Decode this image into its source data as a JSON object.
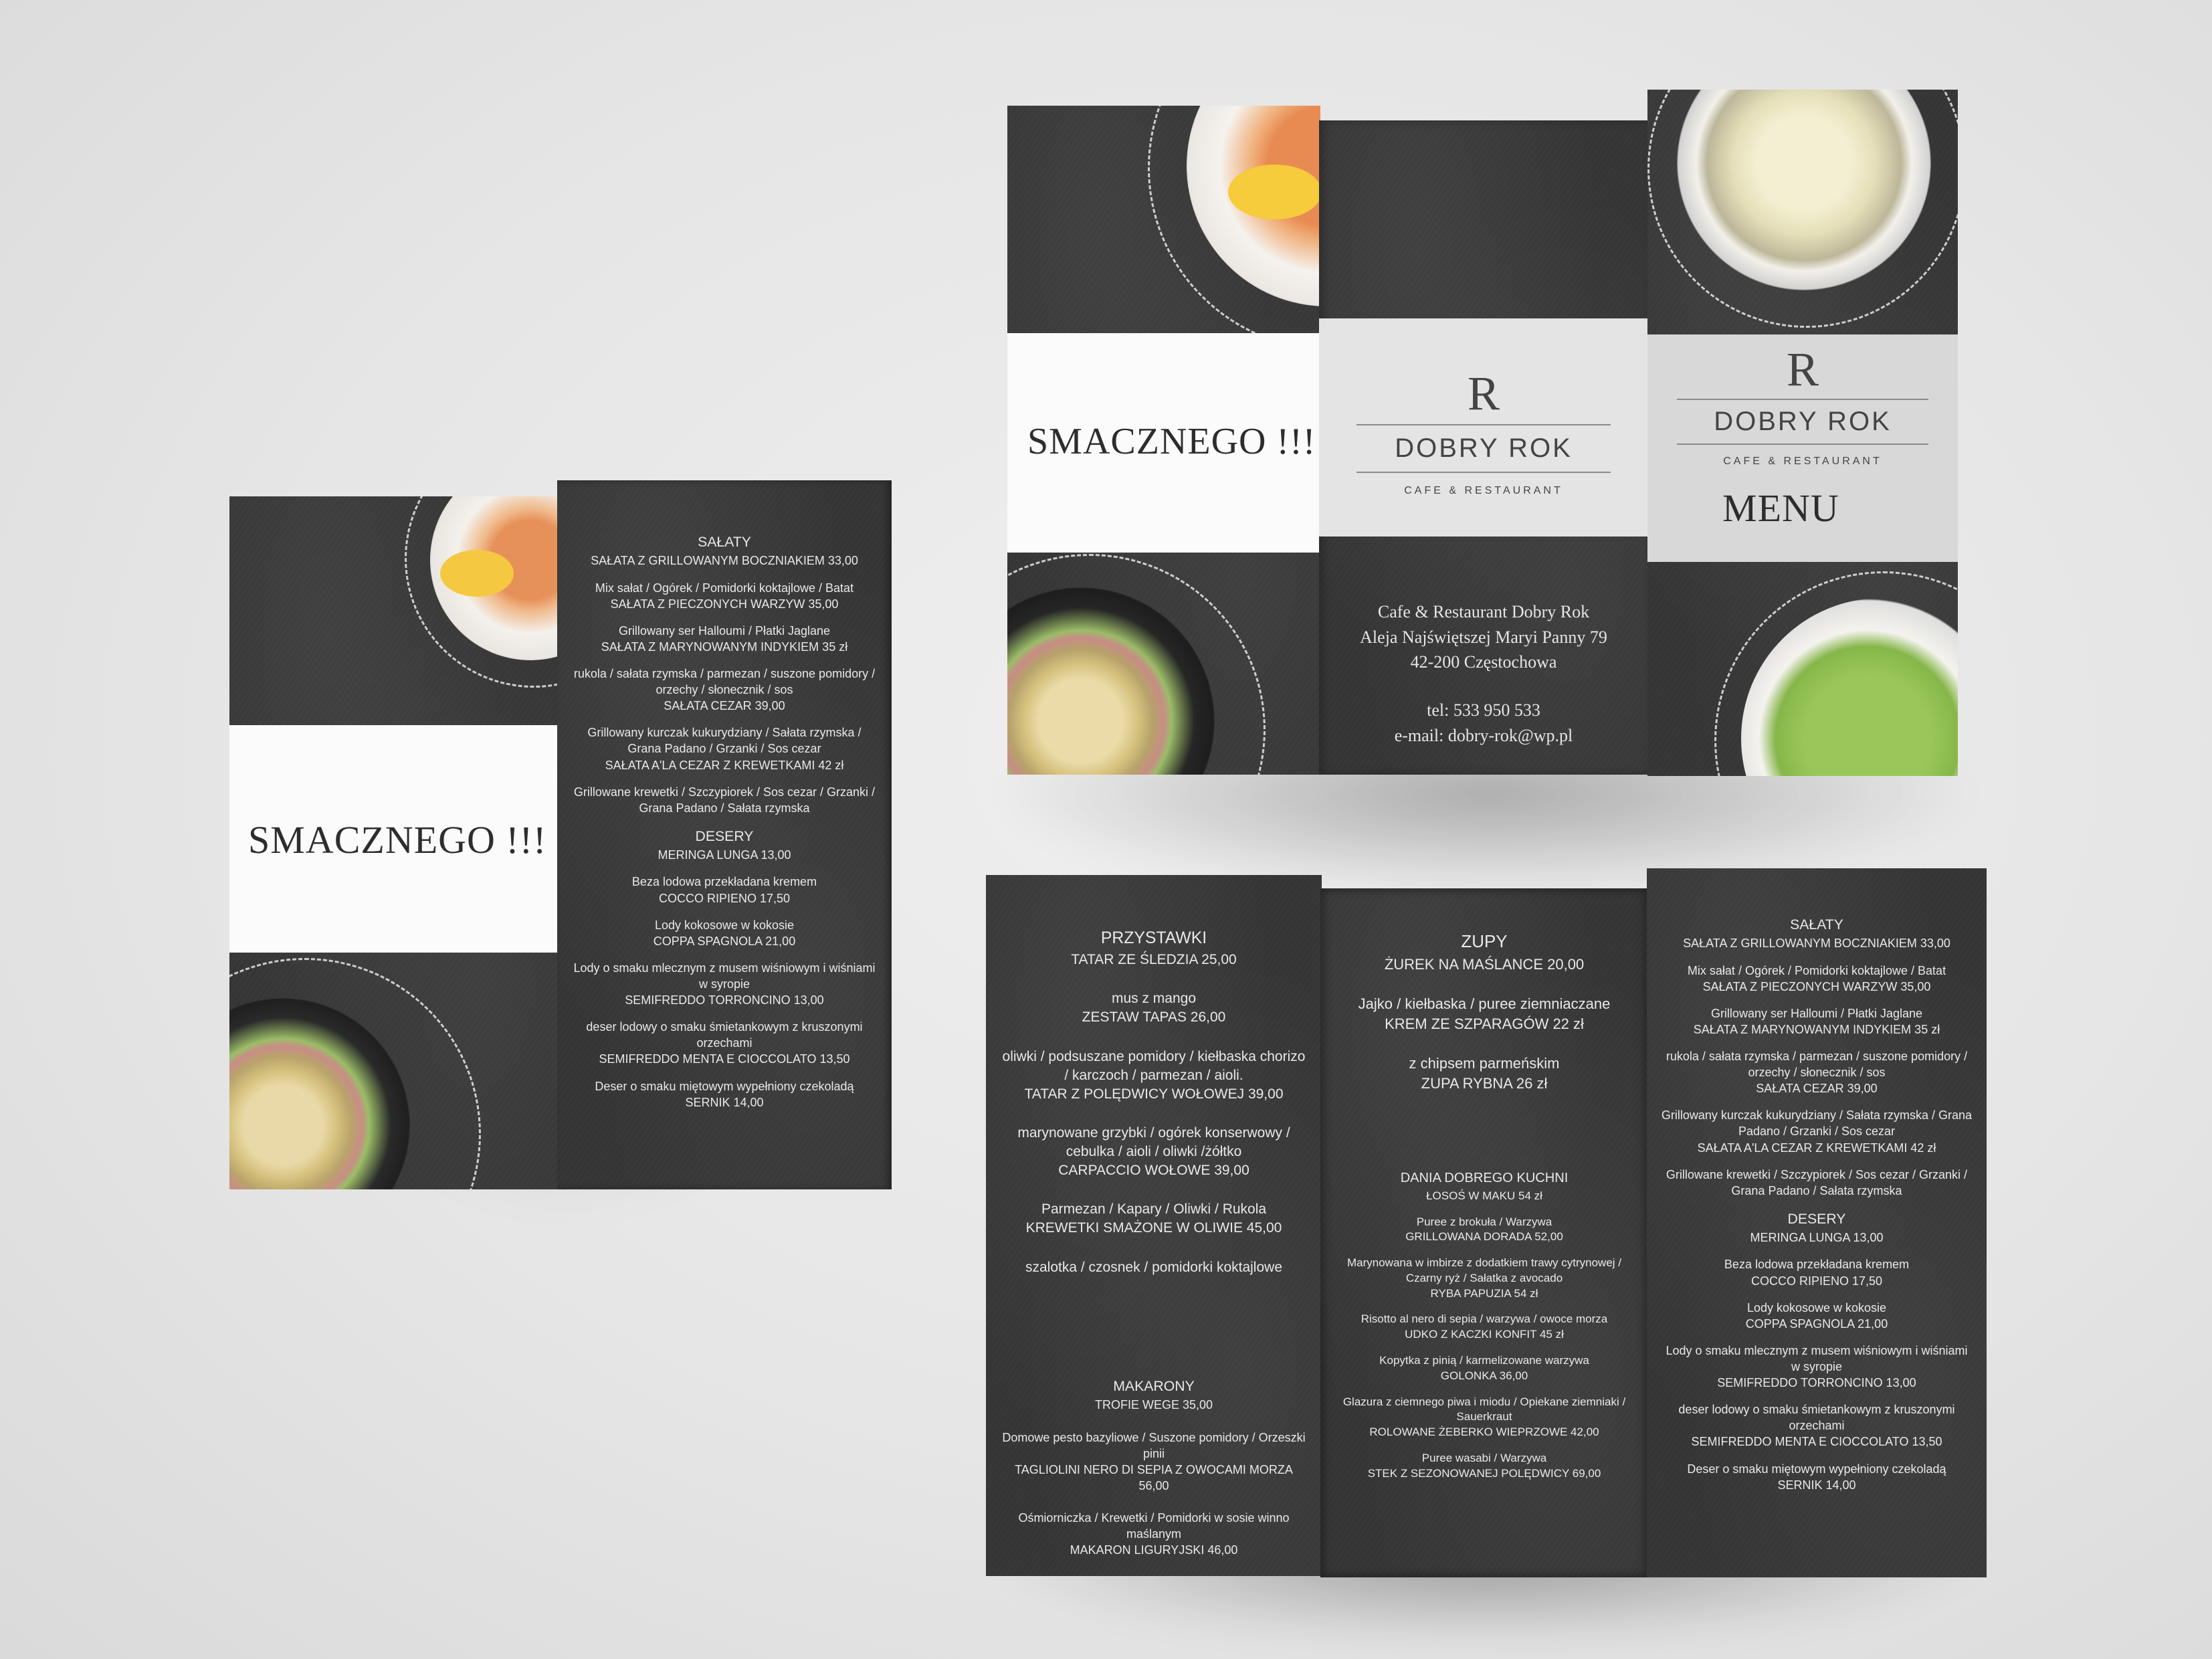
{
  "left_menu": {
    "cover_text": "SMACZNEGO !!!",
    "items": [
      {
        "head": "SAŁATY",
        "name": "SAŁATA Z GRILLOWANYM BOCZNIAKIEM 33,00"
      },
      {
        "desc": "Mix sałat / Ogórek / Pomidorki koktajlowe / Batat",
        "name": "SAŁATA Z PIECZONYCH WARZYW 35,00"
      },
      {
        "desc": "Grillowany ser Halloumi / Płatki Jaglane",
        "name": "SAŁATA Z MARYNOWANYM INDYKIEM 35 zł"
      },
      {
        "desc": "rukola / sałata rzymska / parmezan / suszone pomidory / orzechy / słonecznik / sos",
        "name": "SAŁATA CEZAR 39,00"
      },
      {
        "desc": "Grillowany kurczak kukurydziany / Sałata rzymska / Grana Padano / Grzanki / Sos cezar",
        "name": "SAŁATA A'LA CEZAR Z KREWETKAMI 42 zł"
      },
      {
        "desc": "Grillowane krewetki / Szczypiorek / Sos cezar / Grzanki / Grana Padano / Sałata rzymska",
        "name": ""
      },
      {
        "head": "DESERY",
        "name": "MERINGA LUNGA 13,00"
      },
      {
        "desc": "Beza lodowa przekładana kremem",
        "name": "COCCO RIPIENO 17,50"
      },
      {
        "desc": "Lody kokosowe w kokosie",
        "name": "COPPA SPAGNOLA 21,00"
      },
      {
        "desc": "Lody o smaku mlecznym z musem wiśniowym i wiśniami w syropie",
        "name": "SEMIFREDDO TORRONCINO 13,00"
      },
      {
        "desc": "deser lodowy o smaku śmietankowym z kruszonymi orzechami",
        "name": "SEMIFREDDO MENTA E CIOCCOLATO 13,50"
      },
      {
        "desc": "Deser o smaku miętowym wypełniony czekoladą",
        "name": "SERNIK 14,00"
      }
    ]
  },
  "front": {
    "cover_text": "SMACZNEGO !!!",
    "logo_mark": "R",
    "logo_name": "DOBRY ROK",
    "logo_sub": "CAFE & RESTAURANT",
    "menu_title": "MENU",
    "contact": {
      "line1": "Cafe & Restaurant Dobry Rok",
      "line2": "Aleja Najświętszej Maryi Panny 79",
      "line3": "42-200 Częstochowa",
      "tel": "tel: 533 950 533",
      "email": "e-mail: dobry-rok@wp.pl"
    }
  },
  "inside": {
    "col1": [
      {
        "head": "PRZYSTAWKI",
        "name": "TATAR ZE ŚLEDZIA 25,00"
      },
      {
        "desc": "mus z mango",
        "name": "ZESTAW TAPAS 26,00"
      },
      {
        "desc": "oliwki / podsuszane pomidory / kiełbaska chorizo / karczoch / parmezan / aioli.",
        "name": "TATAR Z POLĘDWICY WOŁOWEJ 39,00"
      },
      {
        "desc": "marynowane grzybki / ogórek konserwowy / cebulka / aioli / oliwki /żółtko",
        "name": "CARPACCIO WOŁOWE 39,00"
      },
      {
        "desc": "Parmezan / Kapary / Oliwki / Rukola",
        "name": "KREWETKI SMAŻONE W OLIWIE 45,00"
      },
      {
        "desc": "szalotka / czosnek / pomidorki koktajlowe",
        "name": ""
      }
    ],
    "col1b": [
      {
        "head": "MAKARONY",
        "name": "TROFIE WEGE 35,00"
      },
      {
        "desc": "Domowe pesto bazyliowe / Suszone pomidory / Orzeszki pinii",
        "name": "TAGLIOLINI NERO DI SEPIA Z OWOCAMI MORZA 56,00"
      },
      {
        "desc": "Ośmiorniczka / Krewetki / Pomidorki w sosie winno maślanym",
        "name": "MAKARON LIGURYJSKI 46,00"
      }
    ],
    "col2": [
      {
        "head": "ZUPY",
        "name": "ŻUREK NA MAŚLANCE 20,00"
      },
      {
        "desc": "Jajko / kiełbaska / puree ziemniaczane",
        "name": "KREM ZE SZPARAGÓW 22 zł"
      },
      {
        "desc": "z chipsem parmeńskim",
        "name": "ZUPA RYBNA 26 zł"
      }
    ],
    "col2b": [
      {
        "head": "DANIA DOBREGO KUCHNI",
        "name": "ŁOSOŚ W MAKU 54 zł"
      },
      {
        "desc": "Puree z brokuła / Warzywa",
        "name": "GRILLOWANA DORADA 52,00"
      },
      {
        "desc": "Marynowana w imbirze z dodatkiem trawy cytrynowej / Czarny ryż / Sałatka z avocado",
        "name": "RYBA PAPUZIA 54 zł"
      },
      {
        "desc": "Risotto al nero di sepia / warzywa / owoce morza",
        "name": "UDKO Z KACZKI KONFIT 45 zł"
      },
      {
        "desc": "Kopytka z pinią / karmelizowane warzywa",
        "name": "GOLONKA 36,00"
      },
      {
        "desc": "Glazura z ciemnego piwa i miodu / Opiekane ziemniaki / Sauerkraut",
        "name": "ROLOWANE ŻEBERKO WIEPRZOWE 42,00"
      },
      {
        "desc": "Puree wasabi / Warzywa",
        "name": "STEK Z SEZONOWANEJ POLĘDWICY 69,00"
      }
    ],
    "col3": [
      {
        "head": "SAŁATY",
        "name": "SAŁATA Z GRILLOWANYM BOCZNIAKIEM 33,00"
      },
      {
        "desc": "Mix sałat / Ogórek / Pomidorki koktajlowe / Batat",
        "name": "SAŁATA Z PIECZONYCH WARZYW 35,00"
      },
      {
        "desc": "Grillowany ser Halloumi / Płatki Jaglane",
        "name": "SAŁATA Z MARYNOWANYM INDYKIEM 35 zł"
      },
      {
        "desc": "rukola / sałata rzymska / parmezan / suszone pomidory / orzechy / słonecznik / sos",
        "name": "SAŁATA CEZAR 39,00"
      },
      {
        "desc": "Grillowany kurczak kukurydziany / Sałata rzymska / Grana Padano / Grzanki / Sos cezar",
        "name": "SAŁATA A'LA CEZAR Z KREWETKAMI 42 zł"
      },
      {
        "desc": "Grillowane krewetki / Szczypiorek / Sos cezar / Grzanki / Grana Padano / Sałata rzymska",
        "name": ""
      },
      {
        "head": "DESERY",
        "name": "MERINGA LUNGA 13,00"
      },
      {
        "desc": "Beza lodowa przekładana kremem",
        "name": "COCCO RIPIENO 17,50"
      },
      {
        "desc": "Lody kokosowe w kokosie",
        "name": "COPPA SPAGNOLA 21,00"
      },
      {
        "desc": "Lody o smaku mlecznym z musem wiśniowym i wiśniami w syropie",
        "name": "SEMIFREDDO TORRONCINO 13,00"
      },
      {
        "desc": "deser lodowy o smaku śmietankowym z kruszonymi orzechami",
        "name": "SEMIFREDDO MENTA E CIOCCOLATO 13,50"
      },
      {
        "desc": "Deser o smaku miętowym wypełniony czekoladą",
        "name": "SERNIK 14,00"
      }
    ]
  }
}
